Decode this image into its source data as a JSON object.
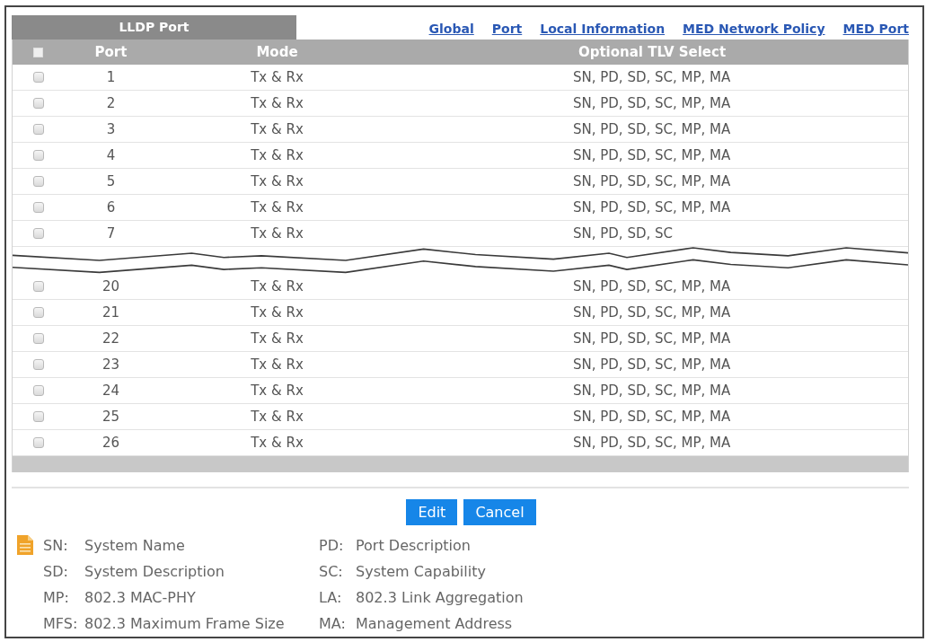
{
  "panel_title": "LLDP Port",
  "nav_links": [
    "Global",
    "Port",
    "Local Information",
    "MED Network Policy",
    "MED Port"
  ],
  "table": {
    "columns": [
      "Port",
      "Mode",
      "Optional TLV Select"
    ],
    "select_all": {
      "checked": false
    },
    "rows": [
      {
        "kind": "row",
        "checked": false,
        "port": "1",
        "mode": "Tx & Rx",
        "tlv": "SN, PD, SD, SC, MP, MA"
      },
      {
        "kind": "row",
        "checked": false,
        "port": "2",
        "mode": "Tx & Rx",
        "tlv": "SN, PD, SD, SC, MP, MA"
      },
      {
        "kind": "row",
        "checked": false,
        "port": "3",
        "mode": "Tx & Rx",
        "tlv": "SN, PD, SD, SC, MP, MA"
      },
      {
        "kind": "row",
        "checked": false,
        "port": "4",
        "mode": "Tx & Rx",
        "tlv": "SN, PD, SD, SC, MP, MA"
      },
      {
        "kind": "row",
        "checked": false,
        "port": "5",
        "mode": "Tx & Rx",
        "tlv": "SN, PD, SD, SC, MP, MA"
      },
      {
        "kind": "row",
        "checked": false,
        "port": "6",
        "mode": "Tx & Rx",
        "tlv": "SN, PD, SD, SC, MP, MA"
      },
      {
        "kind": "row",
        "checked": false,
        "port": "7",
        "mode": "Tx & Rx",
        "tlv": "SN, PD, SD, SC"
      },
      {
        "kind": "break"
      },
      {
        "kind": "row",
        "checked": false,
        "port": "20",
        "mode": "Tx & Rx",
        "tlv": "SN, PD, SD, SC, MP, MA"
      },
      {
        "kind": "row",
        "checked": false,
        "port": "21",
        "mode": "Tx & Rx",
        "tlv": "SN, PD, SD, SC, MP, MA"
      },
      {
        "kind": "row",
        "checked": false,
        "port": "22",
        "mode": "Tx & Rx",
        "tlv": "SN, PD, SD, SC, MP, MA"
      },
      {
        "kind": "row",
        "checked": false,
        "port": "23",
        "mode": "Tx & Rx",
        "tlv": "SN, PD, SD, SC, MP, MA"
      },
      {
        "kind": "row",
        "checked": false,
        "port": "24",
        "mode": "Tx & Rx",
        "tlv": "SN, PD, SD, SC, MP, MA"
      },
      {
        "kind": "row",
        "checked": false,
        "port": "25",
        "mode": "Tx & Rx",
        "tlv": "SN, PD, SD, SC, MP, MA"
      },
      {
        "kind": "row",
        "checked": false,
        "port": "26",
        "mode": "Tx & Rx",
        "tlv": "SN, PD, SD, SC, MP, MA"
      }
    ]
  },
  "buttons": [
    "Edit",
    "Cancel"
  ],
  "legend": [
    {
      "abbr": "SN:",
      "text": "System Name"
    },
    {
      "abbr": "PD:",
      "text": "Port Description"
    },
    {
      "abbr": "SD:",
      "text": "System Description"
    },
    {
      "abbr": "SC:",
      "text": "System Capability"
    },
    {
      "abbr": "MP:",
      "text": "802.3 MAC-PHY"
    },
    {
      "abbr": "LA:",
      "text": "802.3 Link Aggregation"
    },
    {
      "abbr": "MFS:",
      "text": "802.3 Maximum Frame Size"
    },
    {
      "abbr": "MA:",
      "text": "Management Address"
    }
  ]
}
